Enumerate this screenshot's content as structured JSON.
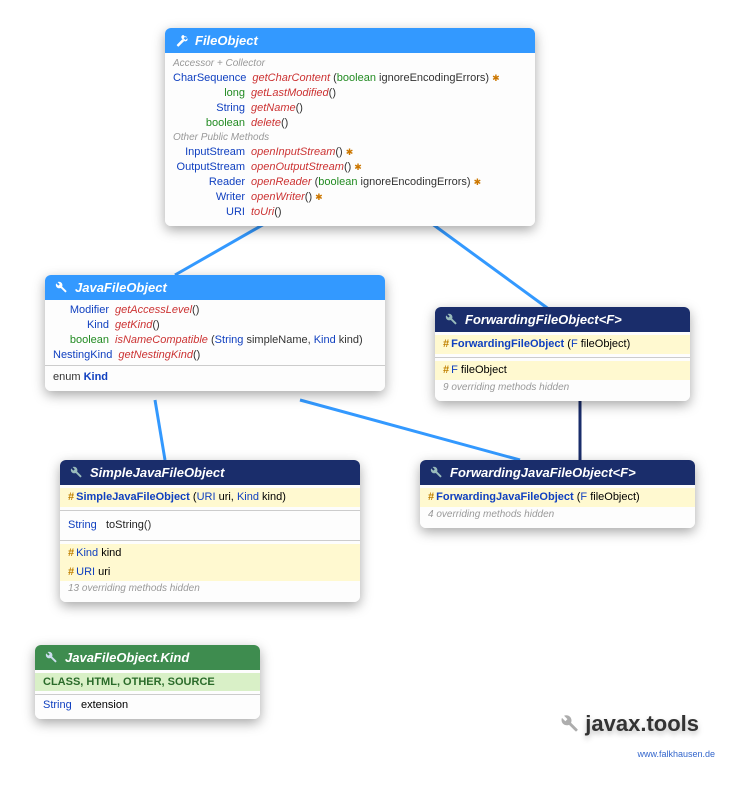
{
  "package": "javax.tools",
  "credit": "www.falkhausen.de",
  "classes": {
    "fileObject": {
      "title": "FileObject",
      "sections": {
        "accessor": "Accessor + Collector",
        "other": "Other Public Methods"
      },
      "methods": {
        "m1": {
          "ret": "CharSequence",
          "name": "getCharContent",
          "params": "(boolean ignoreEncodingErrors)",
          "mark": "✱"
        },
        "m2": {
          "ret": "long",
          "name": "getLastModified",
          "params": "()"
        },
        "m3": {
          "ret": "String",
          "name": "getName",
          "params": "()"
        },
        "m4": {
          "ret": "boolean",
          "name": "delete",
          "params": "()"
        },
        "m5": {
          "ret": "InputStream",
          "name": "openInputStream",
          "params": "()",
          "mark": "✱"
        },
        "m6": {
          "ret": "OutputStream",
          "name": "openOutputStream",
          "params": "()",
          "mark": "✱"
        },
        "m7": {
          "ret": "Reader",
          "name": "openReader",
          "params": "(boolean ignoreEncodingErrors)",
          "mark": "✱"
        },
        "m8": {
          "ret": "Writer",
          "name": "openWriter",
          "params": "()",
          "mark": "✱"
        },
        "m9": {
          "ret": "URI",
          "name": "toUri",
          "params": "()"
        }
      }
    },
    "javaFileObject": {
      "title": "JavaFileObject",
      "methods": {
        "m1": {
          "ret": "Modifier",
          "name": "getAccessLevel",
          "params": "()"
        },
        "m2": {
          "ret": "Kind",
          "name": "getKind",
          "params": "()"
        },
        "m3": {
          "ret": "boolean",
          "name": "isNameCompatible",
          "params_pre": "(String simpleName, ",
          "param_type": "Kind",
          "params_post": " kind)"
        },
        "m4": {
          "ret": "NestingKind",
          "name": "getNestingKind",
          "params": "()"
        }
      },
      "enum": "enum Kind"
    },
    "forwardingFileObject": {
      "title": "ForwardingFileObject",
      "tparam": "<F>",
      "ctor": {
        "name": "ForwardingFileObject",
        "params": "(F fileObject)"
      },
      "field": {
        "type": "F",
        "name": "fileObject"
      },
      "hidden": "9 overriding methods hidden"
    },
    "simpleJavaFileObject": {
      "title": "SimpleJavaFileObject",
      "ctor": {
        "name": "SimpleJavaFileObject",
        "params_pre": "(URI uri, ",
        "param_type": "Kind",
        "params_post": " kind)"
      },
      "method": {
        "ret": "String",
        "name": "toString",
        "params": "()"
      },
      "fields": {
        "f1": {
          "type": "Kind",
          "name": "kind"
        },
        "f2": {
          "type": "URI",
          "name": "uri"
        }
      },
      "hidden": "13 overriding methods hidden"
    },
    "forwardingJavaFileObject": {
      "title": "ForwardingJavaFileObject",
      "tparam": "<F>",
      "ctor": {
        "name": "ForwardingJavaFileObject",
        "params": "(F fileObject)"
      },
      "hidden": "4 overriding methods hidden"
    },
    "kind": {
      "title": "JavaFileObject.Kind",
      "values": "CLASS, HTML, OTHER, SOURCE",
      "field": {
        "ret": "String",
        "name": "extension"
      }
    }
  }
}
